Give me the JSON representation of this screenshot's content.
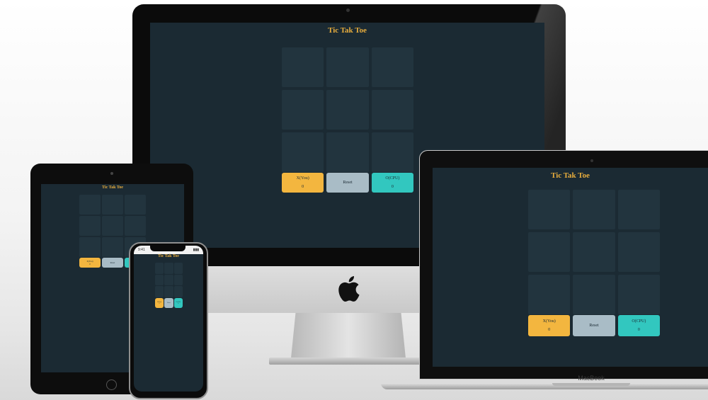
{
  "game": {
    "title": "Tic Tak Toe",
    "x_label": "X(You)",
    "reset_label": "Reset",
    "o_label": "O(CPU)",
    "x_score": "0",
    "o_score": "0"
  },
  "devices": {
    "macbook_label": "MacBook",
    "iphone_time": "9:41"
  },
  "colors": {
    "screen_bg": "#1b2a33",
    "cell_bg": "#22343e",
    "title": "#e8ad3d",
    "x_button": "#f3b63f",
    "reset_button": "#a9bcc6",
    "o_button": "#32c7bf"
  }
}
